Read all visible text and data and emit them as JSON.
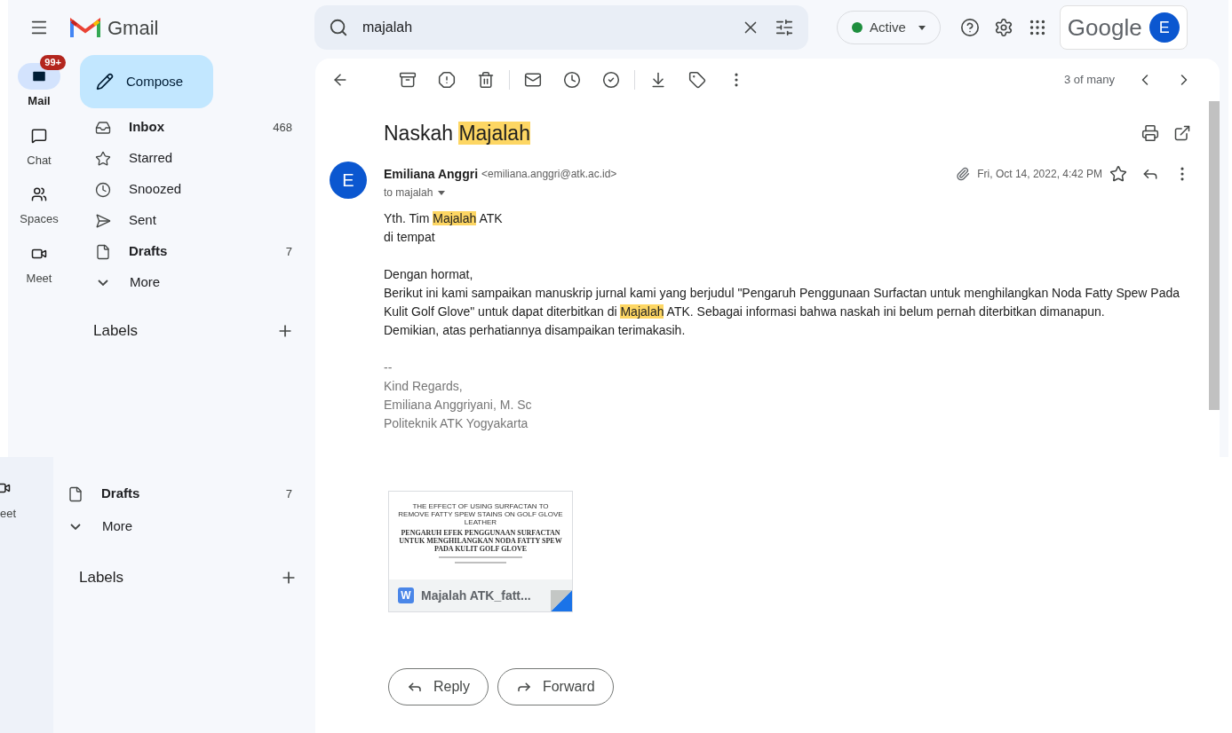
{
  "header": {
    "app_name": "Gmail",
    "search_value": "majalah",
    "status": "Active",
    "account_brand": "Google",
    "avatar_letter": "E"
  },
  "rail": [
    {
      "label": "Mail",
      "selected": true,
      "badge": "99+",
      "kind": "mail"
    },
    {
      "label": "Chat",
      "selected": false,
      "kind": "chat"
    },
    {
      "label": "Spaces",
      "selected": false,
      "kind": "spaces"
    },
    {
      "label": "Meet",
      "selected": false,
      "kind": "meet"
    }
  ],
  "compose": "Compose",
  "folders": [
    {
      "label": "Inbox",
      "count": "468",
      "bold": true,
      "kind": "inbox"
    },
    {
      "label": "Starred",
      "bold": false,
      "kind": "star"
    },
    {
      "label": "Snoozed",
      "bold": false,
      "kind": "clock"
    },
    {
      "label": "Sent",
      "bold": false,
      "kind": "sent"
    },
    {
      "label": "Drafts",
      "count": "7",
      "bold": true,
      "kind": "drafts"
    },
    {
      "label": "More",
      "bold": false,
      "kind": "more"
    }
  ],
  "labels_heading": "Labels",
  "pagination": "3 of many",
  "subject": [
    {
      "text": "Naskah ",
      "highlighted": false
    },
    {
      "text": "Majalah",
      "highlighted": true
    }
  ],
  "message": {
    "avatar_letter": "E",
    "sender": "Emiliana Anggri",
    "address": "<emiliana.anggri@atk.ac.id>",
    "date": "Fri, Oct 14, 2022, 4:42 PM",
    "recipient": "to majalah",
    "body": [
      [
        [
          {
            "text": "Yth. Tim ",
            "highlighted": false
          },
          {
            "text": "Majalah",
            "highlighted": true
          },
          {
            "text": " ATK",
            "highlighted": false
          }
        ],
        [
          {
            "text": "di tempat",
            "highlighted": false
          }
        ]
      ],
      [
        [
          {
            "text": "Dengan hormat,",
            "highlighted": false
          }
        ],
        [
          {
            "text": "Berikut ini kami sampaikan manuskrip jurnal kami yang berjudul \"Pengaruh Penggunaan Surfactan untuk menghilangkan Noda Fatty Spew Pada Kulit Golf Glove\" untuk dapat diterbitkan di ",
            "highlighted": false
          },
          {
            "text": "Majalah",
            "highlighted": true
          },
          {
            "text": " ATK. Sebagai informasi bahwa naskah ini belum pernah diterbitkan dimanapun.",
            "highlighted": false
          }
        ],
        [
          {
            "text": "Demikian, atas perhatiannya disampaikan terimakasih.",
            "highlighted": false
          }
        ]
      ]
    ],
    "signature": [
      "--",
      "Kind Regards,",
      "Emiliana Anggriyani, M. Sc",
      "Politeknik ATK Yogyakarta"
    ]
  },
  "lower": {
    "rail_label": "eet",
    "folders": [
      {
        "label": "Drafts",
        "count": "7",
        "bold": true,
        "kind": "drafts"
      },
      {
        "label": "More",
        "bold": false,
        "kind": "more"
      }
    ],
    "labels_heading": "Labels",
    "attachment": {
      "preview_title": "THE EFFECT OF USING SURFACTAN TO REMOVE FATTY SPEW STAINS ON GOLF GLOVE LEATHER",
      "preview_subtitle": "PENGARUH EFEK PENGGUNAAN SURFACTAN UNTUK MENGHILANGKAN NODA FATTY SPEW PADA KULIT GOLF GLOVE",
      "type_letter": "W",
      "filename": "Majalah ATK_fatt..."
    },
    "buttons": [
      {
        "label": "Reply",
        "kind": "reply"
      },
      {
        "label": "Forward",
        "kind": "forward"
      }
    ]
  }
}
